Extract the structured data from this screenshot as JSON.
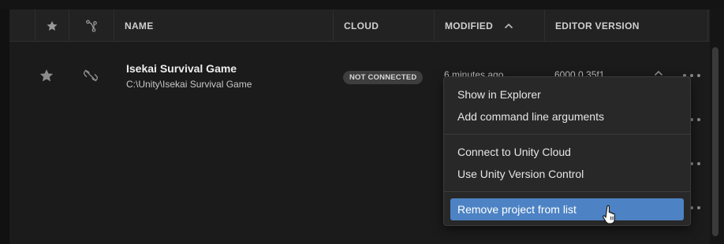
{
  "table": {
    "columns": {
      "name": "NAME",
      "cloud": "CLOUD",
      "modified": "MODIFIED",
      "editor_version": "EDITOR VERSION"
    },
    "sort": {
      "column": "modified",
      "direction": "ascending",
      "icon": "chevron-up-icon"
    },
    "rows": [
      {
        "name": "Isekai Survival Game",
        "path": "C:\\Unity\\Isekai Survival Game",
        "cloud_status": "NOT CONNECTED",
        "modified": "6 minutes ago",
        "editor_version": "6000.0.35f1"
      }
    ]
  },
  "context_menu": {
    "items": [
      {
        "label": "Show in Explorer"
      },
      {
        "label": "Add command line arguments"
      },
      {
        "label": "Connect to Unity Cloud"
      },
      {
        "label": "Use Unity Version Control"
      },
      {
        "label": "Remove project from list",
        "highlighted": true
      }
    ]
  },
  "colors": {
    "highlight": "#4d83c4",
    "background": "#1b1b1b",
    "header": "#222222",
    "menu": "#282828"
  },
  "icons": [
    "star-icon",
    "branch-icon",
    "unlinked-icon",
    "chevron-up-icon",
    "more-icon",
    "hand-cursor-icon"
  ]
}
